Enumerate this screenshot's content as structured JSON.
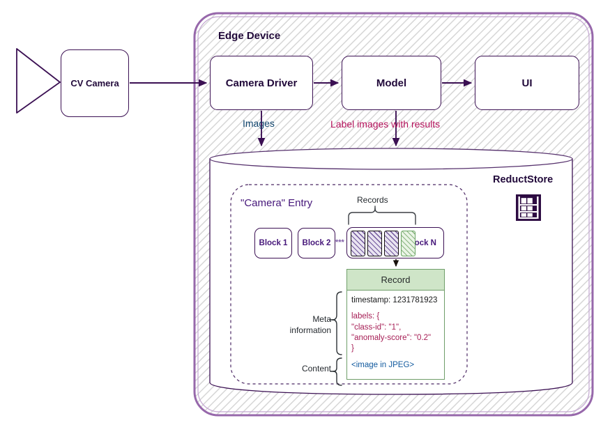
{
  "diagram": {
    "title": "Edge Device",
    "external": {
      "camera_label": "CV Camera",
      "lens_icon": "camera-lens-triangle-icon"
    },
    "pipeline": [
      {
        "id": "camera-driver",
        "label": "Camera Driver"
      },
      {
        "id": "model",
        "label": "Model"
      },
      {
        "id": "ui",
        "label": "UI"
      }
    ],
    "flow_labels": {
      "images": "Images",
      "images_color": "#10456e",
      "label_images": "Label images with results",
      "label_images_color": "#b4125b"
    },
    "database": {
      "name": "ReductStore",
      "icon": "storage-shelf-icon",
      "icon_color": "#3b1053",
      "entry_title": "\"Camera\" Entry",
      "entry_title_color": "#46177a",
      "records_bracket_label": "Records",
      "blocks": [
        {
          "label": "Block 1"
        },
        {
          "label": "Block 2"
        },
        {
          "label": "Block N"
        }
      ],
      "blocks_ellipsis": "***",
      "record_chips": [
        {
          "kind": "purple"
        },
        {
          "kind": "purple"
        },
        {
          "kind": "purple"
        },
        {
          "kind": "green"
        }
      ],
      "record_card": {
        "header": "Record",
        "header_bg": "#cfe5c8",
        "border_color": "#6f9e69",
        "timestamp_line": "timestamp: 1231781923",
        "meta_lines": [
          "labels: {",
          " \"class-id\": \"1\",",
          " \"anomaly-score\": \"0.2\"",
          "}"
        ],
        "content_line": "<image in JPEG>",
        "side_labels": {
          "meta": "Meta\ninformation",
          "content": "Content"
        }
      }
    },
    "colors": {
      "stroke_dark": "#3b1053",
      "edge_border": "#9768ab",
      "hatch": "#d9d9d9",
      "accent_purple": "#46177a"
    }
  }
}
